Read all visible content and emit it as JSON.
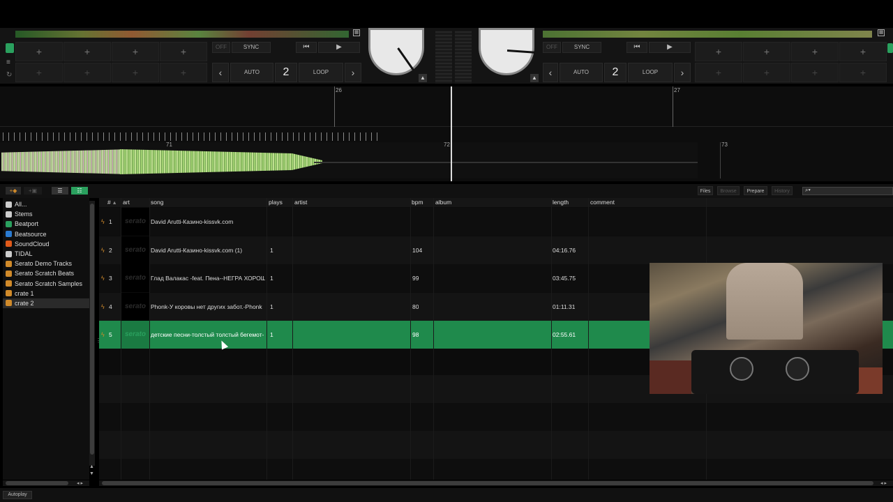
{
  "decks": {
    "left": {
      "sync_label": "SYNC",
      "off_label": "OFF",
      "auto_label": "AUTO",
      "loop_label": "LOOP",
      "loop_value": "2"
    },
    "right": {
      "sync_label": "SYNC",
      "off_label": "OFF",
      "auto_label": "AUTO",
      "loop_label": "LOOP",
      "loop_value": "2"
    }
  },
  "beat_labels": {
    "upper_left": "26",
    "upper_right": "27",
    "lower_1": "71",
    "lower_2": "72",
    "lower_3": "73"
  },
  "toolbar": {
    "files": "Files",
    "browse": "Browse",
    "prepare": "Prepare",
    "history": "History"
  },
  "sidebar": {
    "items": [
      {
        "label": "All...",
        "icon": "all-icon",
        "color": "#cccccc"
      },
      {
        "label": "Stems",
        "icon": "stems-icon",
        "color": "#cccccc"
      },
      {
        "label": "Beatport",
        "icon": "beatport-icon",
        "color": "#2aa05e"
      },
      {
        "label": "Beatsource",
        "icon": "beatsource-icon",
        "color": "#2a7ad0"
      },
      {
        "label": "SoundCloud",
        "icon": "soundcloud-icon",
        "color": "#e05a1a"
      },
      {
        "label": "TIDAL",
        "icon": "tidal-icon",
        "color": "#cccccc"
      },
      {
        "label": "Serato Demo Tracks",
        "icon": "crate-icon",
        "color": "#d08a2a"
      },
      {
        "label": "Serato Scratch Beats",
        "icon": "crate-icon",
        "color": "#d08a2a"
      },
      {
        "label": "Serato Scratch Samples",
        "icon": "crate-icon",
        "color": "#d08a2a"
      },
      {
        "label": "crate 1",
        "icon": "crate-icon",
        "color": "#d08a2a"
      },
      {
        "label": "crate 2",
        "icon": "crate-icon",
        "color": "#d08a2a",
        "selected": true
      }
    ]
  },
  "table": {
    "headers": {
      "num": "#",
      "art": "art",
      "song": "song",
      "plays": "plays",
      "artist": "artist",
      "bpm": "bpm",
      "album": "album",
      "length": "length",
      "comment": "comment"
    },
    "art_placeholder": "serato",
    "rows": [
      {
        "num": "1",
        "song": "David Arutti-Казино-kissvk.com",
        "plays": "",
        "artist": "",
        "bpm": "",
        "album": "",
        "length": "",
        "comment": ""
      },
      {
        "num": "2",
        "song": "David Arutti-Казино-kissvk.com (1)",
        "plays": "1",
        "artist": "",
        "bpm": "104",
        "album": "",
        "length": "04:16.76",
        "comment": ""
      },
      {
        "num": "3",
        "song": "Глад Валакас -feat. Пена--НЕГРА ХОРОШ",
        "plays": "1",
        "artist": "",
        "bpm": "99",
        "album": "",
        "length": "03:45.75",
        "comment": ""
      },
      {
        "num": "4",
        "song": "Phonk-У коровы нет других забот.-Phonk",
        "plays": "1",
        "artist": "",
        "bpm": "80",
        "album": "",
        "length": "01:11.31",
        "comment": ""
      },
      {
        "num": "5",
        "song": "детские песни-толстый толстый бегемот-",
        "plays": "1",
        "artist": "",
        "bpm": "98",
        "album": "",
        "length": "02:55.61",
        "comment": "",
        "selected": true
      }
    ]
  },
  "bottom": {
    "autoplay": "Autoplay"
  },
  "colors": {
    "selection": "#1f8a4c",
    "accent_orange": "#d08a2a"
  }
}
